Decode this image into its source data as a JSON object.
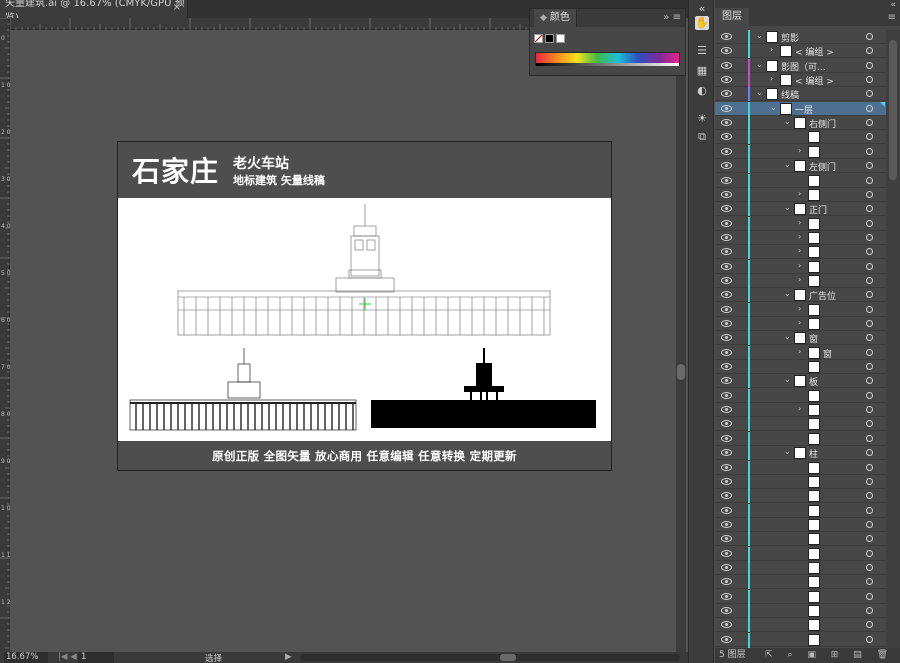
{
  "document": {
    "tab_title": "矢量建筑.ai @ 16.67% (CMYK/GPU 预览)",
    "close_label": "×"
  },
  "rulers": {
    "top_labels": [
      "",
      "",
      "",
      ""
    ],
    "left_labels": [
      "0",
      "1 0",
      "2 0",
      "3 0",
      "4 0",
      "5 0",
      "6 0",
      "7 0",
      "8 0",
      "9 0",
      "1 0 0",
      "1 1 0",
      "1 2 0"
    ]
  },
  "artboard": {
    "title": "石家庄",
    "subtitle1": "老火车站",
    "subtitle2": "地标建筑 矢量线稿",
    "footer": "原创正版 全图矢量 放心商用 任意编辑 任意转换 定期更新"
  },
  "color_panel": {
    "tab_label": "颜色",
    "collapse": "»",
    "menu": "≡"
  },
  "layers_panel": {
    "tab_label": "图层",
    "collapse": "«",
    "menu": "≡",
    "footer_count": "5 图层",
    "footer_icons": "⇱ ⌕ ▣ ⊞ ▤ 🗑",
    "accent_colors": {
      "cyan": "#3fd7d7",
      "magenta": "#c04fd0",
      "blue": "#6a7cff",
      "selection": "#4e6f8f"
    },
    "rows": [
      {
        "indent": 0,
        "twirl": "v",
        "label": "剪影",
        "bar": "cyan",
        "thumb": true
      },
      {
        "indent": 1,
        "twirl": ">",
        "label": "< 编组 >",
        "bar": "cyan",
        "thumb": true
      },
      {
        "indent": 0,
        "twirl": "v",
        "label": "影图（可...",
        "bar": "magenta",
        "thumb": true
      },
      {
        "indent": 1,
        "twirl": ">",
        "label": "< 编组 >",
        "bar": "magenta",
        "thumb": true
      },
      {
        "indent": 0,
        "twirl": "v",
        "label": "线稿",
        "bar": "blue",
        "thumb": true
      },
      {
        "indent": 1,
        "twirl": "v",
        "label": "一层",
        "bar": "cyan",
        "thumb": true,
        "selected": true
      },
      {
        "indent": 2,
        "twirl": "v",
        "label": "右侧门",
        "bar": "cyan",
        "thumb": true
      },
      {
        "indent": 3,
        "twirl": "",
        "label": "",
        "bar": "cyan",
        "thumb": true
      },
      {
        "indent": 3,
        "twirl": ">",
        "label": "",
        "bar": "cyan",
        "thumb": true
      },
      {
        "indent": 2,
        "twirl": "v",
        "label": "左侧门",
        "bar": "cyan",
        "thumb": true
      },
      {
        "indent": 3,
        "twirl": "",
        "label": "",
        "bar": "cyan",
        "thumb": true
      },
      {
        "indent": 3,
        "twirl": ">",
        "label": "",
        "bar": "cyan",
        "thumb": true
      },
      {
        "indent": 2,
        "twirl": "v",
        "label": "正门",
        "bar": "cyan",
        "thumb": true
      },
      {
        "indent": 3,
        "twirl": ">",
        "label": "",
        "bar": "cyan",
        "thumb": true
      },
      {
        "indent": 3,
        "twirl": ">",
        "label": "",
        "bar": "cyan",
        "thumb": true
      },
      {
        "indent": 3,
        "twirl": ">",
        "label": "",
        "bar": "cyan",
        "thumb": true
      },
      {
        "indent": 3,
        "twirl": ">",
        "label": "",
        "bar": "cyan",
        "thumb": true
      },
      {
        "indent": 3,
        "twirl": ">",
        "label": "",
        "bar": "cyan",
        "thumb": true
      },
      {
        "indent": 2,
        "twirl": "v",
        "label": "广告位",
        "bar": "cyan",
        "thumb": true
      },
      {
        "indent": 3,
        "twirl": ">",
        "label": "",
        "bar": "cyan",
        "thumb": true
      },
      {
        "indent": 3,
        "twirl": ">",
        "label": "",
        "bar": "cyan",
        "thumb": true
      },
      {
        "indent": 2,
        "twirl": "v",
        "label": "窗",
        "bar": "cyan",
        "thumb": true
      },
      {
        "indent": 3,
        "twirl": ">",
        "label": "窗",
        "bar": "cyan",
        "thumb": true
      },
      {
        "indent": 3,
        "twirl": "",
        "label": "",
        "bar": "cyan",
        "thumb": true
      },
      {
        "indent": 2,
        "twirl": "v",
        "label": "板",
        "bar": "cyan",
        "thumb": true
      },
      {
        "indent": 3,
        "twirl": "",
        "label": "",
        "bar": "cyan",
        "thumb": true
      },
      {
        "indent": 3,
        "twirl": ">",
        "label": "",
        "bar": "cyan",
        "thumb": true
      },
      {
        "indent": 3,
        "twirl": "",
        "label": "",
        "bar": "cyan",
        "thumb": true
      },
      {
        "indent": 3,
        "twirl": "",
        "label": "",
        "bar": "cyan",
        "thumb": true
      },
      {
        "indent": 2,
        "twirl": "v",
        "label": "柱",
        "bar": "cyan",
        "thumb": true
      },
      {
        "indent": 3,
        "twirl": "",
        "label": "",
        "bar": "cyan",
        "thumb": true
      },
      {
        "indent": 3,
        "twirl": "",
        "label": "",
        "bar": "cyan",
        "thumb": true
      },
      {
        "indent": 3,
        "twirl": "",
        "label": "",
        "bar": "cyan",
        "thumb": true
      },
      {
        "indent": 3,
        "twirl": "",
        "label": "",
        "bar": "cyan",
        "thumb": true
      },
      {
        "indent": 3,
        "twirl": "",
        "label": "",
        "bar": "cyan",
        "thumb": true
      },
      {
        "indent": 3,
        "twirl": "",
        "label": "",
        "bar": "cyan",
        "thumb": true
      },
      {
        "indent": 3,
        "twirl": "",
        "label": "",
        "bar": "cyan",
        "thumb": true
      },
      {
        "indent": 3,
        "twirl": "",
        "label": "",
        "bar": "cyan",
        "thumb": true
      },
      {
        "indent": 3,
        "twirl": "",
        "label": "",
        "bar": "cyan",
        "thumb": true
      },
      {
        "indent": 3,
        "twirl": "",
        "label": "",
        "bar": "cyan",
        "thumb": true
      },
      {
        "indent": 3,
        "twirl": "",
        "label": "",
        "bar": "cyan",
        "thumb": true
      },
      {
        "indent": 3,
        "twirl": "",
        "label": "",
        "bar": "cyan",
        "thumb": true
      },
      {
        "indent": 3,
        "twirl": "",
        "label": "",
        "bar": "cyan",
        "thumb": true
      },
      {
        "indent": 3,
        "twirl": "",
        "label": "",
        "bar": "cyan",
        "thumb": true
      }
    ]
  },
  "status_bar": {
    "zoom": "16.67%",
    "page": "1",
    "tool_name": "选择",
    "nav_prev": "|◀ ◀",
    "arrow": "▶"
  },
  "tools": [
    "hand-icon",
    "properties-icon",
    "swatches-icon",
    "gradient-icon",
    "appearance-icon",
    "export-icon",
    "layers-icon"
  ]
}
